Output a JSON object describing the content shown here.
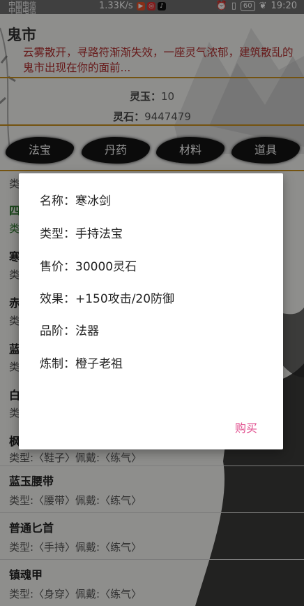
{
  "status": {
    "carrier_top": "中国电信",
    "carrier_bottom": "中国电信",
    "speed": "1.33K/s",
    "battery": "60",
    "time": "19:20"
  },
  "header": {
    "title": "鬼市",
    "intro": "云雾散开，寻路符渐渐失效，一座灵气浓郁，建筑散乱的鬼市出现在你的面前..."
  },
  "stats": {
    "lingyu_label": "灵玉：",
    "lingyu_value": "10",
    "lingshi_label": "灵石：",
    "lingshi_value": "9447479"
  },
  "tabs": [
    "法宝",
    "丹药",
    "材料",
    "道具"
  ],
  "list": {
    "partial_chars": [
      "类",
      "四",
      "类",
      "寒",
      "类",
      "赤",
      "类",
      "蓝",
      "类",
      "白",
      "类",
      "枫"
    ],
    "items": [
      {
        "name": "",
        "desc": "类型:〈鞋子〉佩戴:〈练气〉"
      },
      {
        "name": "蓝玉腰带",
        "desc": "类型:〈腰带〉佩戴:〈练气〉"
      },
      {
        "name": "普通匕首",
        "desc": "类型:〈手持〉佩戴:〈练气〉"
      },
      {
        "name": "镇魂甲",
        "desc": "类型:〈身穿〉佩戴:〈练气〉"
      }
    ]
  },
  "dialog": {
    "name_label": "名称：",
    "name_value": "寒冰剑",
    "type_label": "类型：",
    "type_value": "手持法宝",
    "price_label": "售价：",
    "price_value": "30000灵石",
    "effect_label": "效果：",
    "effect_value": "+150攻击/20防御",
    "grade_label": "品阶：",
    "grade_value": "法器",
    "maker_label": "炼制：",
    "maker_value": "橙子老祖",
    "buy_label": "购买"
  },
  "colors": {
    "intro_text": "#b23030",
    "gold_line": "#c8901c",
    "buy_button": "#e04d8d"
  }
}
